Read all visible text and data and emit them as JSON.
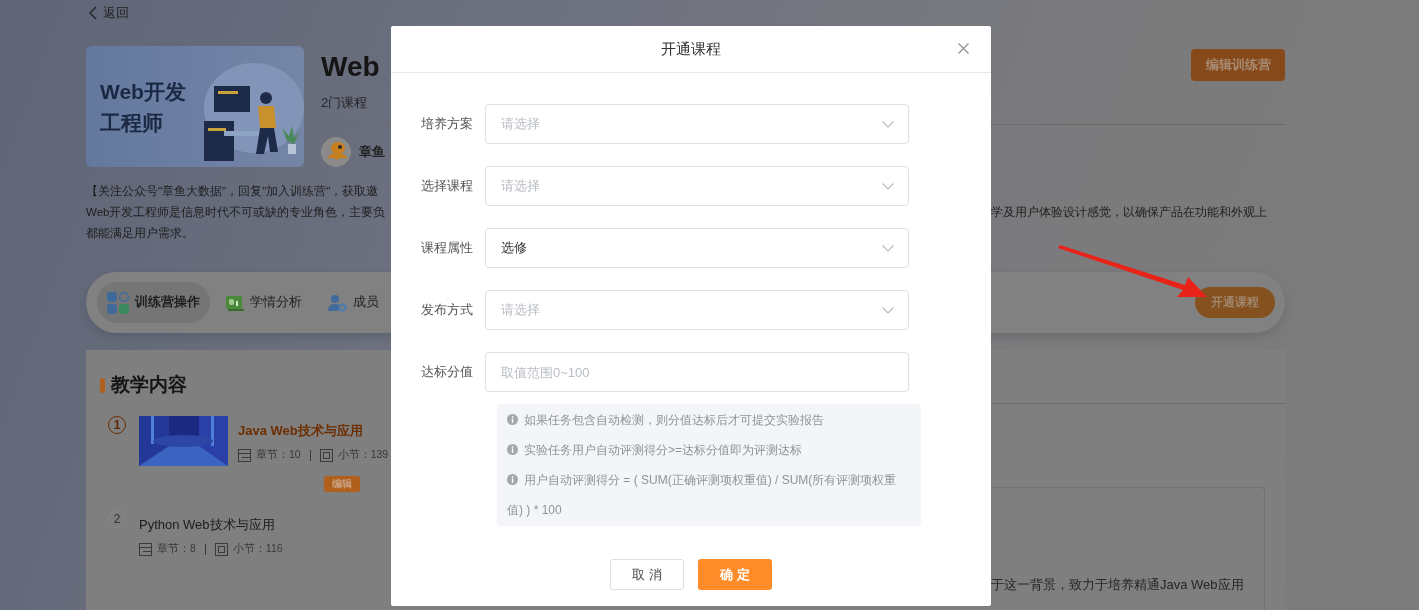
{
  "back_link": "返回",
  "banner": {
    "title_lines": [
      "Web开发",
      "工程师"
    ]
  },
  "camp": {
    "title": "Web",
    "course_count": "2门课程",
    "author": "章鱼",
    "edit_button": "编辑训练营"
  },
  "description": {
    "lines": [
      {
        "left": "【关注公众号\"章鱼大数据\"，回复\"加入训练营\"，获取邀"
      },
      {
        "left": "Web开发工程师是信息时代不可或缺的专业角色，主要负",
        "right": "学及用户体验设计感觉，以确保产品在功能和外观上"
      },
      {
        "left": "都能满足用户需求。"
      }
    ]
  },
  "toolbar": {
    "tabs": [
      {
        "label": "训练营操作",
        "kind": "apps",
        "selected": true
      },
      {
        "label": "学情分析",
        "kind": "chart",
        "selected": false
      },
      {
        "label": "成员",
        "kind": "members",
        "selected": false
      }
    ],
    "open_button": "开通课程"
  },
  "content": {
    "heading": "教学内容",
    "courses": [
      {
        "index": "1",
        "title": "Java Web技术与应用",
        "chapters": "章节：10",
        "sections": "小节：139",
        "selected": true,
        "thumbnail": {
          "kind": "picture"
        },
        "actions": [
          "编辑"
        ]
      },
      {
        "index": "2",
        "title": "Python Web技术与应用",
        "chapters": "章节：8",
        "sections": "小节：116",
        "selected": false
      }
    ],
    "side_text": "于这一背景，致力于培养精通Java Web应用"
  },
  "dialog": {
    "title": "开通课程",
    "fields": [
      {
        "label": "培养方案",
        "kind": "select",
        "placeholder": "请选择"
      },
      {
        "label": "选择课程",
        "kind": "select",
        "placeholder": "请选择"
      },
      {
        "label": "课程属性",
        "kind": "select",
        "value": "选修"
      },
      {
        "label": "发布方式",
        "kind": "select",
        "placeholder": "请选择"
      },
      {
        "label": "达标分值",
        "kind": "input",
        "placeholder": "取值范围0~100"
      }
    ],
    "tips": [
      "如果任务包含自动检测，则分值达标后才可提交实验报告",
      "实验任务用户自动评测得分>=达标分值即为评测达标",
      "用户自动评测得分 = ( SUM(正确评测项权重值) / SUM(所有评测项权重值) ) * 100"
    ],
    "buttons": [
      {
        "label": "取 消",
        "kind": "secondary"
      },
      {
        "label": "确 定",
        "kind": "primary"
      }
    ]
  }
}
